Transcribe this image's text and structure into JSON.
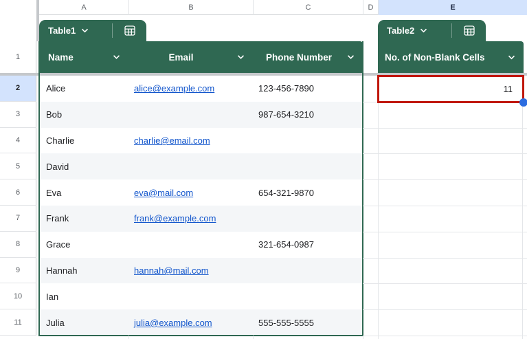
{
  "grid": {
    "column_letters": [
      "A",
      "B",
      "C",
      "D",
      "E"
    ],
    "row_numbers": [
      "1",
      "2",
      "3",
      "4",
      "5",
      "6",
      "7",
      "8",
      "9",
      "10",
      "11"
    ]
  },
  "table1": {
    "tab_label": "Table1",
    "headers": {
      "name": "Name",
      "email": "Email",
      "phone": "Phone Number"
    },
    "rows": [
      {
        "name": "Alice",
        "email": "alice@example.com",
        "phone": "123-456-7890"
      },
      {
        "name": "Bob",
        "email": "",
        "phone": "987-654-3210"
      },
      {
        "name": "Charlie",
        "email": "charlie@email.com",
        "phone": ""
      },
      {
        "name": "David",
        "email": "",
        "phone": ""
      },
      {
        "name": "Eva",
        "email": "eva@mail.com",
        "phone": "654-321-9870"
      },
      {
        "name": "Frank",
        "email": "frank@example.com",
        "phone": ""
      },
      {
        "name": "Grace",
        "email": "",
        "phone": "321-654-0987"
      },
      {
        "name": "Hannah",
        "email": "hannah@mail.com",
        "phone": ""
      },
      {
        "name": "Ian",
        "email": "",
        "phone": ""
      },
      {
        "name": "Julia",
        "email": "julia@example.com",
        "phone": "555-555-5555"
      }
    ]
  },
  "table2": {
    "tab_label": "Table2",
    "header": "No. of Non-Blank Cells",
    "selected_cell_value": "11"
  },
  "colors": {
    "table_green": "#2f6852",
    "selection_red": "#c0170c",
    "handle_blue": "#2b6ce0",
    "header_highlight": "#d3e3fd",
    "link_blue": "#1155cc",
    "banding_gray": "#f4f6f8"
  }
}
